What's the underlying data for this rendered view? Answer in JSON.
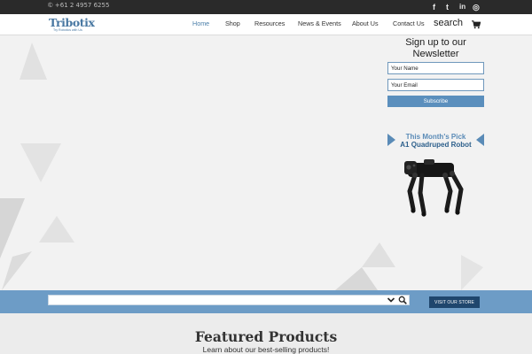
{
  "topbar": {
    "phone": "+61 2 4957 6255",
    "social": [
      {
        "glyph": "f",
        "icon": "facebook-icon"
      },
      {
        "glyph": "t",
        "icon": "twitter-icon"
      },
      {
        "glyph": "in",
        "icon": "linkedin-icon"
      },
      {
        "glyph": "◎",
        "icon": "instagram-icon"
      }
    ]
  },
  "header": {
    "logo": {
      "word": "Tribotix",
      "tagline": "Try Robotics with Us"
    },
    "nav": [
      {
        "label": "Home",
        "active": true
      },
      {
        "label": "Shop"
      },
      {
        "label": "Resources"
      },
      {
        "label": "News & Events"
      },
      {
        "label": "About Us"
      },
      {
        "label": "Contact Us"
      }
    ],
    "search_label": "search",
    "cart_icon": "cart-icon"
  },
  "newsletter": {
    "title": "Sign up to our Newsletter",
    "name_placeholder": "Your Name",
    "email_placeholder": "Your Email",
    "button_label": "Subscribe"
  },
  "monthly_pick": {
    "line1": "This Month's Pick",
    "line2": "A1 Quadruped Robot"
  },
  "product_search": {
    "placeholder": "",
    "store_button": "Visit our store"
  },
  "featured": {
    "title": "Featured Products",
    "subtitle": "Learn about our best-selling products!"
  },
  "colors": {
    "accent": "#5b8fbd",
    "dark_accent": "#1f466d",
    "band": "#6d9cc6",
    "topbar": "#2a2a2a"
  }
}
